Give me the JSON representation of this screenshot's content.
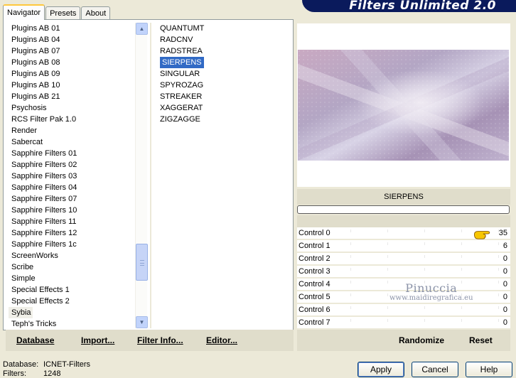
{
  "header": {
    "title": "Filters Unlimited 2.0"
  },
  "tabs": [
    {
      "label": "Navigator",
      "active": true
    },
    {
      "label": "Presets",
      "active": false
    },
    {
      "label": "About",
      "active": false
    }
  ],
  "categories": [
    "Plugins AB 01",
    "Plugins AB 04",
    "Plugins AB 07",
    "Plugins AB 08",
    "Plugins AB 09",
    "Plugins AB 10",
    "Plugins AB 21",
    "Psychosis",
    "RCS Filter Pak 1.0",
    "Render",
    "Sabercat",
    "Sapphire Filters 01",
    "Sapphire Filters 02",
    "Sapphire Filters 03",
    "Sapphire Filters 04",
    "Sapphire Filters 07",
    "Sapphire Filters 10",
    "Sapphire Filters 11",
    "Sapphire Filters 12",
    "Sapphire Filters 1c",
    "ScreenWorks",
    "Scribe",
    "Simple",
    "Special Effects 1",
    "Special Effects 2",
    "Sybia",
    "Teph's Tricks"
  ],
  "highlighted_category": "Sybia",
  "filters": [
    "QUANTUMT",
    "RADCNV",
    "RADSTREA",
    "SIERPENS",
    "SINGULAR",
    "SPYROZAG",
    "STREAKER",
    "XAGGERAT",
    "ZIGZAGGE"
  ],
  "selected_filter": "SIERPENS",
  "left_buttons": {
    "database": "Database",
    "import": "Import...",
    "filter_info": "Filter Info...",
    "editor": "Editor..."
  },
  "preview": {
    "filter_name": "SIERPENS",
    "progress": 0
  },
  "controls": [
    {
      "label": "Control 0",
      "value": "35"
    },
    {
      "label": "Control 1",
      "value": "6"
    },
    {
      "label": "Control 2",
      "value": "0"
    },
    {
      "label": "Control 3",
      "value": "0"
    },
    {
      "label": "Control 4",
      "value": "0"
    },
    {
      "label": "Control 5",
      "value": "0"
    },
    {
      "label": "Control 6",
      "value": "0"
    },
    {
      "label": "Control 7",
      "value": "0"
    }
  ],
  "watermark": {
    "name": "Pinuccia",
    "url": "www.maidiregrafica.eu"
  },
  "right_buttons": {
    "randomize": "Randomize",
    "reset": "Reset"
  },
  "status": {
    "database_label": "Database:",
    "database_value": "ICNET-Filters",
    "filters_label": "Filters:",
    "filters_value": "1248"
  },
  "dialog_buttons": {
    "apply": "Apply",
    "cancel": "Cancel",
    "help": "Help"
  },
  "colors": {
    "selection": "#316ac5",
    "banner": "#0a1a5c",
    "panel": "#ece9d8"
  }
}
